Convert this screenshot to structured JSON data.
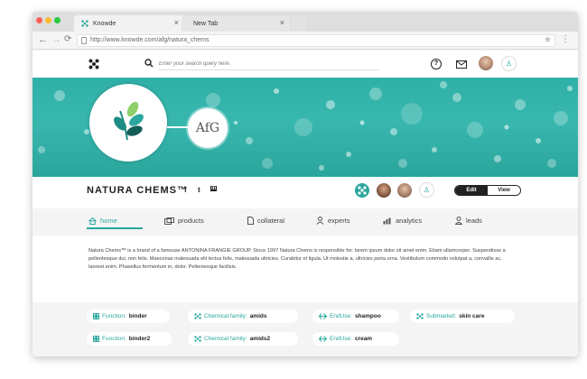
{
  "browser": {
    "tabs": [
      {
        "title": "Knowde",
        "close": "×"
      },
      {
        "title": "New Tab",
        "close": "×"
      }
    ],
    "url": "http://www.knowde.com/afg/natura_chems",
    "traffic_lights": [
      "#fd5f57",
      "#febc2e",
      "#28c840"
    ]
  },
  "header": {
    "search_placeholder": "Enter your search query here.",
    "icons": [
      "knowde-logo-icon",
      "search-icon",
      "help-icon",
      "mail-icon",
      "user-avatar",
      "add-user-icon"
    ],
    "help_glyph": "?"
  },
  "banner": {
    "afg_logo_text": "AfG",
    "accent": "#2fb0a7"
  },
  "profile": {
    "name": "NATURA CHEMS™",
    "social": [
      "f",
      "t",
      "in"
    ],
    "toggle": {
      "edit": "Edit",
      "view": "View"
    }
  },
  "nav_tabs": [
    {
      "label": "home",
      "icon": "home-icon"
    },
    {
      "label": "products",
      "icon": "products-icon"
    },
    {
      "label": "collateral",
      "icon": "document-icon"
    },
    {
      "label": "experts",
      "icon": "experts-icon"
    },
    {
      "label": "analytics",
      "icon": "analytics-icon"
    },
    {
      "label": "leads",
      "icon": "leads-icon"
    }
  ],
  "description": "Natura Chems™ is a brand of a famouse ANTONINA FRANGIE GROUP. Since 1997 Natura Chems is responsible for: lorem ipsum dolor sit amet enim. Etiam ullamcorper. Suspendisse a pellentesque dui, non felis. Maecenas malesuada elit lectus felis, malesuada ultricies. Curabitur et ligula. Ut molestie a, ultricies porta urna. Vestibulum commodo volutpat a, convallis ac, laoreet enim. Phasellus fermentum in, dolor. Pellentesque facilisis.",
  "chips": [
    {
      "label": "Function:",
      "value": "binder"
    },
    {
      "label": "Chemical family:",
      "value": "amids"
    },
    {
      "label": "EndUse:",
      "value": "shampoo"
    },
    {
      "label": "Submarket:",
      "value": "skin care"
    },
    {
      "label": "Function:",
      "value": "binder2"
    },
    {
      "label": "Chemical family:",
      "value": "amids2"
    },
    {
      "label": "EndUse:",
      "value": "cream"
    }
  ]
}
